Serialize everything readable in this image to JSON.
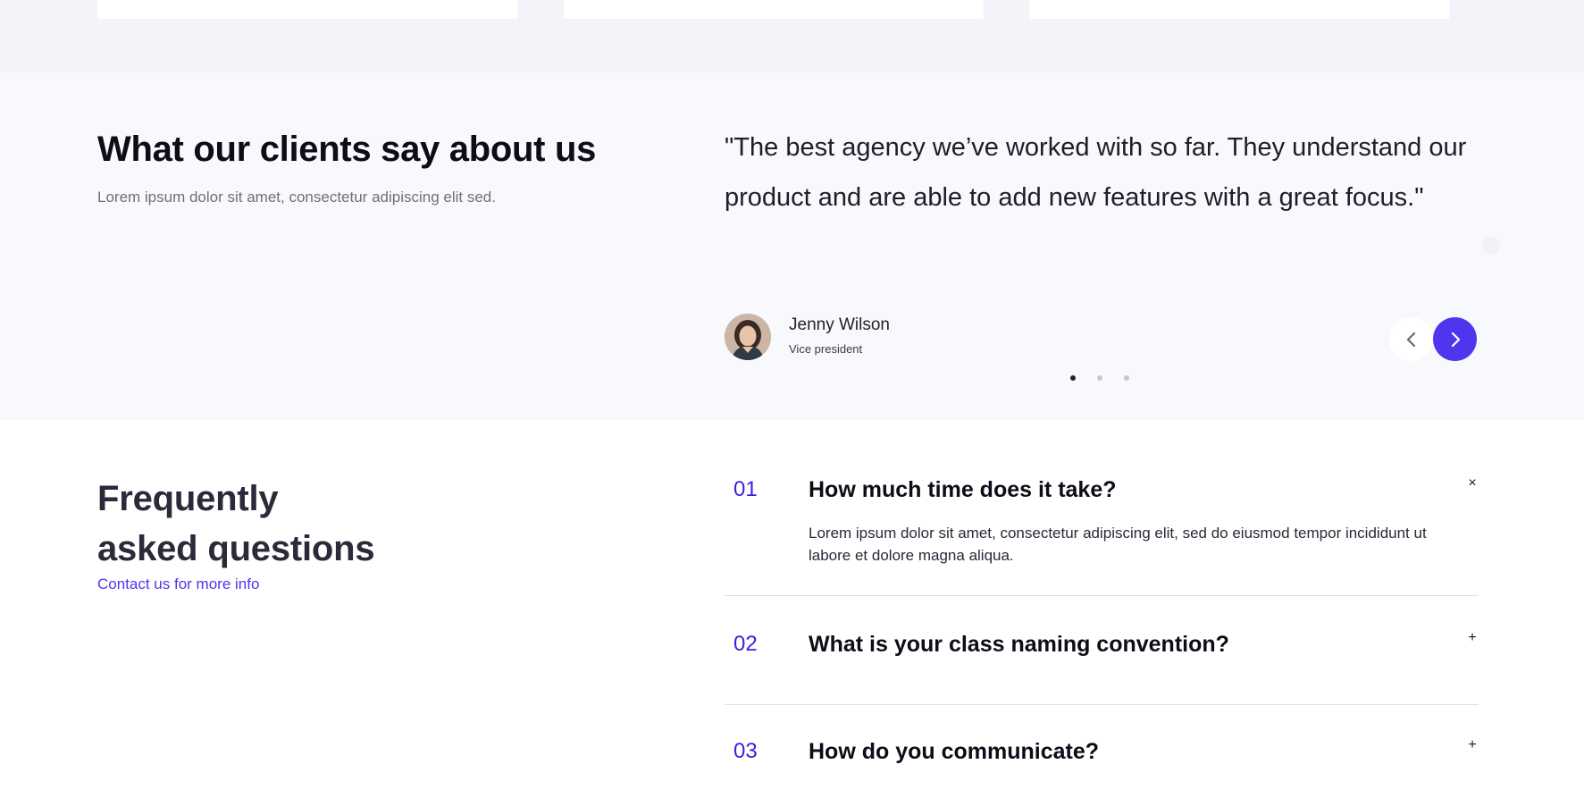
{
  "testimonials": {
    "heading": "What our clients say about us",
    "subheading": "Lorem ipsum dolor sit amet, consectetur adipiscing elit sed.",
    "quote": "\"The best agency we’ve worked with so far. They understand our product and are able to add new features with a great focus.\"",
    "author": {
      "name": "Jenny Wilson",
      "role": "Vice president"
    },
    "slider": {
      "slide_count": 3,
      "active_slide": 1
    },
    "colors": {
      "accent": "#4f36ee",
      "background": "#f8f9fc"
    }
  },
  "faq": {
    "title_line1": "Frequently",
    "title_line2": "asked questions",
    "contact_link": "Contact us for more info",
    "items": [
      {
        "number": "01",
        "question": "How much time does it take?",
        "answer": "Lorem ipsum dolor sit amet, consectetur adipiscing elit, sed do eiusmod tempor incididunt ut labore et dolore magna aliqua.",
        "toggle": "×",
        "expanded": true
      },
      {
        "number": "02",
        "question": "What is your class naming convention?",
        "toggle": "+",
        "expanded": false
      },
      {
        "number": "03",
        "question": "How do you communicate?",
        "toggle": "+",
        "expanded": false
      }
    ]
  }
}
